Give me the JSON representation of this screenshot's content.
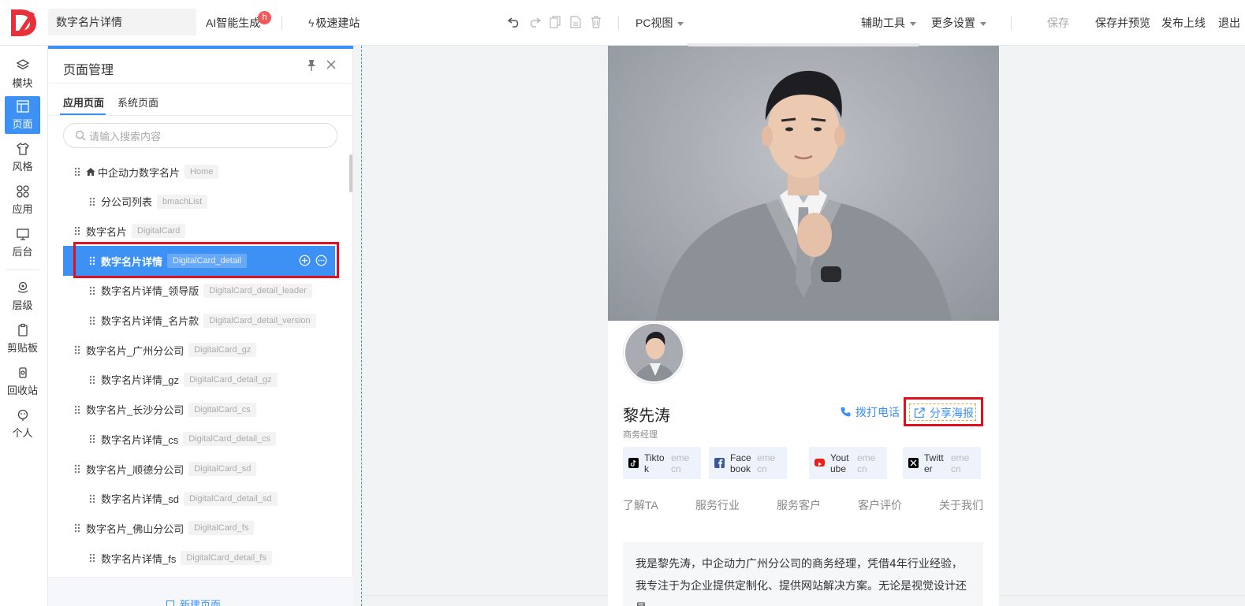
{
  "topbar": {
    "page_name": "数字名片详情",
    "ai_label": "AI智能生成",
    "ai_badge": "h",
    "quick_label": "极速建站",
    "view_label": "PC视图",
    "assist_label": "辅助工具",
    "more_label": "更多设置",
    "save_label": "保存",
    "save_preview_label": "保存并预览",
    "publish_label": "发布上线",
    "exit_label": "退出"
  },
  "rail": {
    "items": [
      {
        "label": "模块",
        "icon": "layers-icon"
      },
      {
        "label": "页面",
        "icon": "page-icon"
      },
      {
        "label": "风格",
        "icon": "shirt-icon"
      },
      {
        "label": "应用",
        "icon": "apps-icon"
      },
      {
        "label": "后台",
        "icon": "monitor-icon"
      },
      {
        "label": "层级",
        "icon": "layer-pin-icon"
      },
      {
        "label": "剪贴板",
        "icon": "clipboard-icon"
      },
      {
        "label": "回收站",
        "icon": "recycle-icon"
      },
      {
        "label": "个人",
        "icon": "user-icon"
      }
    ]
  },
  "panel": {
    "title": "页面管理",
    "tabs": [
      "应用页面",
      "系统页面"
    ],
    "search_placeholder": "请输入搜索内容",
    "pages": [
      {
        "name": "中企动力数字名片",
        "tag": "Home",
        "level": 0,
        "home": true
      },
      {
        "name": "分公司列表",
        "tag": "bmachList",
        "level": 1
      },
      {
        "name": "数字名片",
        "tag": "DigitalCard",
        "level": 0
      },
      {
        "name": "数字名片详情",
        "tag": "DigitalCard_detail",
        "level": 1,
        "selected": true
      },
      {
        "name": "数字名片详情_领导版",
        "tag": "DigitalCard_detail_leader",
        "level": 1
      },
      {
        "name": "数字名片详情_名片款",
        "tag": "DigitalCard_detail_version",
        "level": 1
      },
      {
        "name": "数字名片_广州分公司",
        "tag": "DigitalCard_gz",
        "level": 0
      },
      {
        "name": "数字名片详情_gz",
        "tag": "DigitalCard_detail_gz",
        "level": 1
      },
      {
        "name": "数字名片_长沙分公司",
        "tag": "DigitalCard_cs",
        "level": 0
      },
      {
        "name": "数字名片详情_cs",
        "tag": "DigitalCard_detail_cs",
        "level": 1
      },
      {
        "name": "数字名片_顺德分公司",
        "tag": "DigitalCard_sd",
        "level": 0
      },
      {
        "name": "数字名片详情_sd",
        "tag": "DigitalCard_detail_sd",
        "level": 1
      },
      {
        "name": "数字名片_佛山分公司",
        "tag": "DigitalCard_fs",
        "level": 0
      },
      {
        "name": "数字名片详情_fs",
        "tag": "DigitalCard_detail_fs",
        "level": 1
      }
    ],
    "new_page_label": "新建页面"
  },
  "card": {
    "name": "黎先涛",
    "title": "商务经理",
    "call_label": "拨打电话",
    "share_label": "分享海报",
    "socials": [
      {
        "name": "Tiktok",
        "sub": "emecn",
        "icon": "tiktok-icon",
        "color": "#000000"
      },
      {
        "name": "Facebook",
        "sub": "emecn",
        "icon": "facebook-icon",
        "color": "#3b5998"
      },
      {
        "name": "Youtube",
        "sub": "emecn",
        "icon": "youtube-icon",
        "color": "#e62117"
      },
      {
        "name": "Twitter",
        "sub": "emecn",
        "icon": "x-icon",
        "color": "#000000"
      }
    ],
    "tabs": [
      "了解TA",
      "服务行业",
      "服务客户",
      "客户评价",
      "关于我们"
    ],
    "intro": "我是黎先涛，中企动力广州分公司的商务经理，凭借4年行业经验，我专注于为企业提供定制化、提供网站解决方案。无论是视觉设计还是"
  },
  "colors": {
    "accent": "#3d91f5",
    "highlight_red": "#e0101e",
    "logo_red": "#e8303a"
  }
}
